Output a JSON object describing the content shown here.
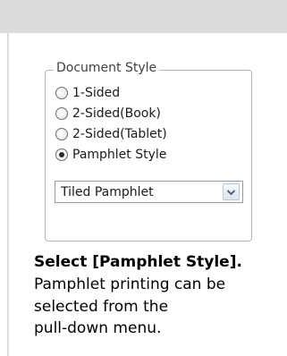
{
  "document_style": {
    "legend": "Document Style",
    "options": [
      {
        "label": "1-Sided",
        "selected": false
      },
      {
        "label": "2-Sided(Book)",
        "selected": false
      },
      {
        "label": "2-Sided(Tablet)",
        "selected": false
      },
      {
        "label": "Pamphlet Style",
        "selected": true
      }
    ],
    "pamphlet_select": {
      "value": "Tiled Pamphlet",
      "icon": "chevron-down-icon"
    }
  },
  "caption": {
    "title": "Select [Pamphlet Style].",
    "lines": [
      "Pamphlet printing can be",
      "selected from the",
      "pull-down menu."
    ]
  },
  "colors": {
    "band": "#dcdcdc",
    "group_border": "#b6b6b6",
    "text": "#000000"
  }
}
